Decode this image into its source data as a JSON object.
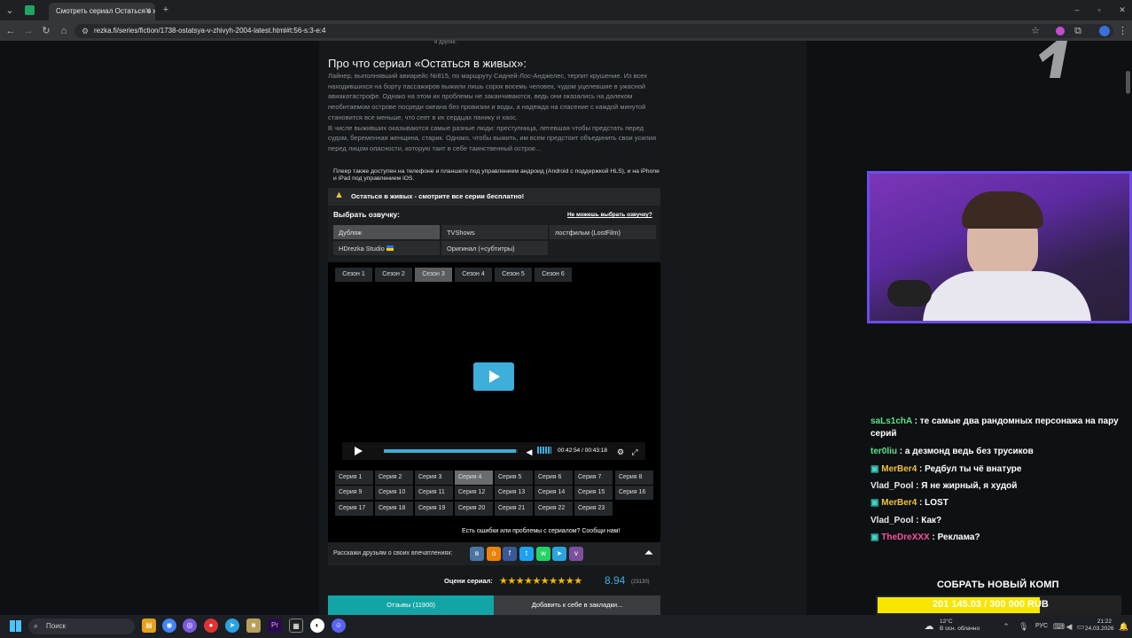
{
  "browser": {
    "tab_title": "Смотреть сериал Остаться в ж",
    "url": "rezka.fi/series/fiction/1738-ostatsya-v-zhivyh-2004-latest.html#t:56-s:3-e:4",
    "top_fragment": "и другие."
  },
  "series": {
    "heading": "Про что сериал «Остаться в живых»:",
    "description_1": "Лайнер, выполнявший авиарейс №815, по маршруту Сидней-Лос-Анджелес, терпит крушение. Из всех находившихся на борту пассажиров выжили лишь сорок восемь человек, чудом уцелевшие в ужасной авиакатастрофе. Однако на этом их проблемы не заканчиваются, ведь они оказались на далеком необитаемом острове посреди океана без провизии и воды, а надежда на спасение с каждой минутой становится все меньше, что сеет в их сердцах панику и хаос.",
    "description_2": "В числе выживших оказываются самые разные люди: преступница, летевшая чтобы предстать перед судом, беременная женщина, старик. Однако, чтобы выжить, им всем предстоит объединить свои усилия перед лицом опасности, которую таит в себе таинственный остров…",
    "player_note": "Плеер также доступен на телефоне и планшете под управлением андроид (Android с поддержкой HLS), и на iPhone и iPad под управлением iOS.",
    "banner": "Остаться в живых - смотрите все серии бесплатно!"
  },
  "voiceover": {
    "label": "Выбрать озвучку:",
    "help_link": "Не можешь выбрать озвучку?",
    "options": [
      "Дубляж",
      "TVShows",
      "лостфильм (LostFilm)",
      "HDrezka Studio",
      "Оригинал (+субтитры)"
    ]
  },
  "seasons": [
    "Сезон 1",
    "Сезон 2",
    "Сезон 3",
    "Сезон 4",
    "Сезон 5",
    "Сезон 6"
  ],
  "player": {
    "time": "00:42:54 / 00:43:18",
    "progress": 0.99
  },
  "episodes": [
    "Серия 1",
    "Серия 2",
    "Серия 3",
    "Серия 4",
    "Серия 5",
    "Серия 6",
    "Серия 7",
    "Серия 8",
    "Серия 9",
    "Серия 10",
    "Серия 11",
    "Серия 12",
    "Серия 13",
    "Серия 14",
    "Серия 15",
    "Серия 16",
    "Серия 17",
    "Серия 18",
    "Серия 19",
    "Серия 20",
    "Серия 21",
    "Серия 22",
    "Серия 23"
  ],
  "report": "Есть ошибки или проблемы с сериалом? Сообщи нам!",
  "share_label": "Расскажи друзьям о своих впечатлениях:",
  "share_icons": [
    "vk",
    "ok",
    "fb",
    "tw",
    "wa",
    "tg",
    "vb"
  ],
  "rating": {
    "label": "Оцени сериал:",
    "value": "8.94",
    "votes": "(23130)",
    "stars": "★★★★★★★★★★"
  },
  "bottom_tabs": {
    "reviews": "Отзывы (11900)",
    "bookmark": "Добавить к себе в закладки..."
  },
  "chat": [
    {
      "user": "saLs1chA",
      "text": ": те самые два рандомных персонажа на пару серий",
      "color": "#5fe08a"
    },
    {
      "user": "ter0liu",
      "text": ": а дезмонд ведь без трусиков",
      "color": "#5fe08a"
    },
    {
      "user": "MerBer4",
      "text": ": Редбул ты чё внатуре",
      "color": "#f0c040"
    },
    {
      "user": "Vlad_Pool",
      "text": ": Я не жирный, я худой",
      "color": "#e8e8e8"
    },
    {
      "user": "MerBer4",
      "text": ": LOST",
      "color": "#f0c040"
    },
    {
      "user": "Vlad_Pool",
      "text": ": Как?",
      "color": "#e8e8e8"
    },
    {
      "user": "TheDreXXX",
      "text": ": Реклама?",
      "color": "#ff4fa0"
    }
  ],
  "donation": {
    "title": "СОБРАТЬ НОВЫЙ КОМП",
    "amount": "201 145.03 / 300 000",
    "currency": "RUB",
    "progress": 0.67
  },
  "taskbar": {
    "search": "Поиск",
    "weather_temp": "12°C",
    "weather_desc": "В осн. облачно",
    "lang": "РУС",
    "time": "21:22",
    "date": "24.03.2026"
  }
}
